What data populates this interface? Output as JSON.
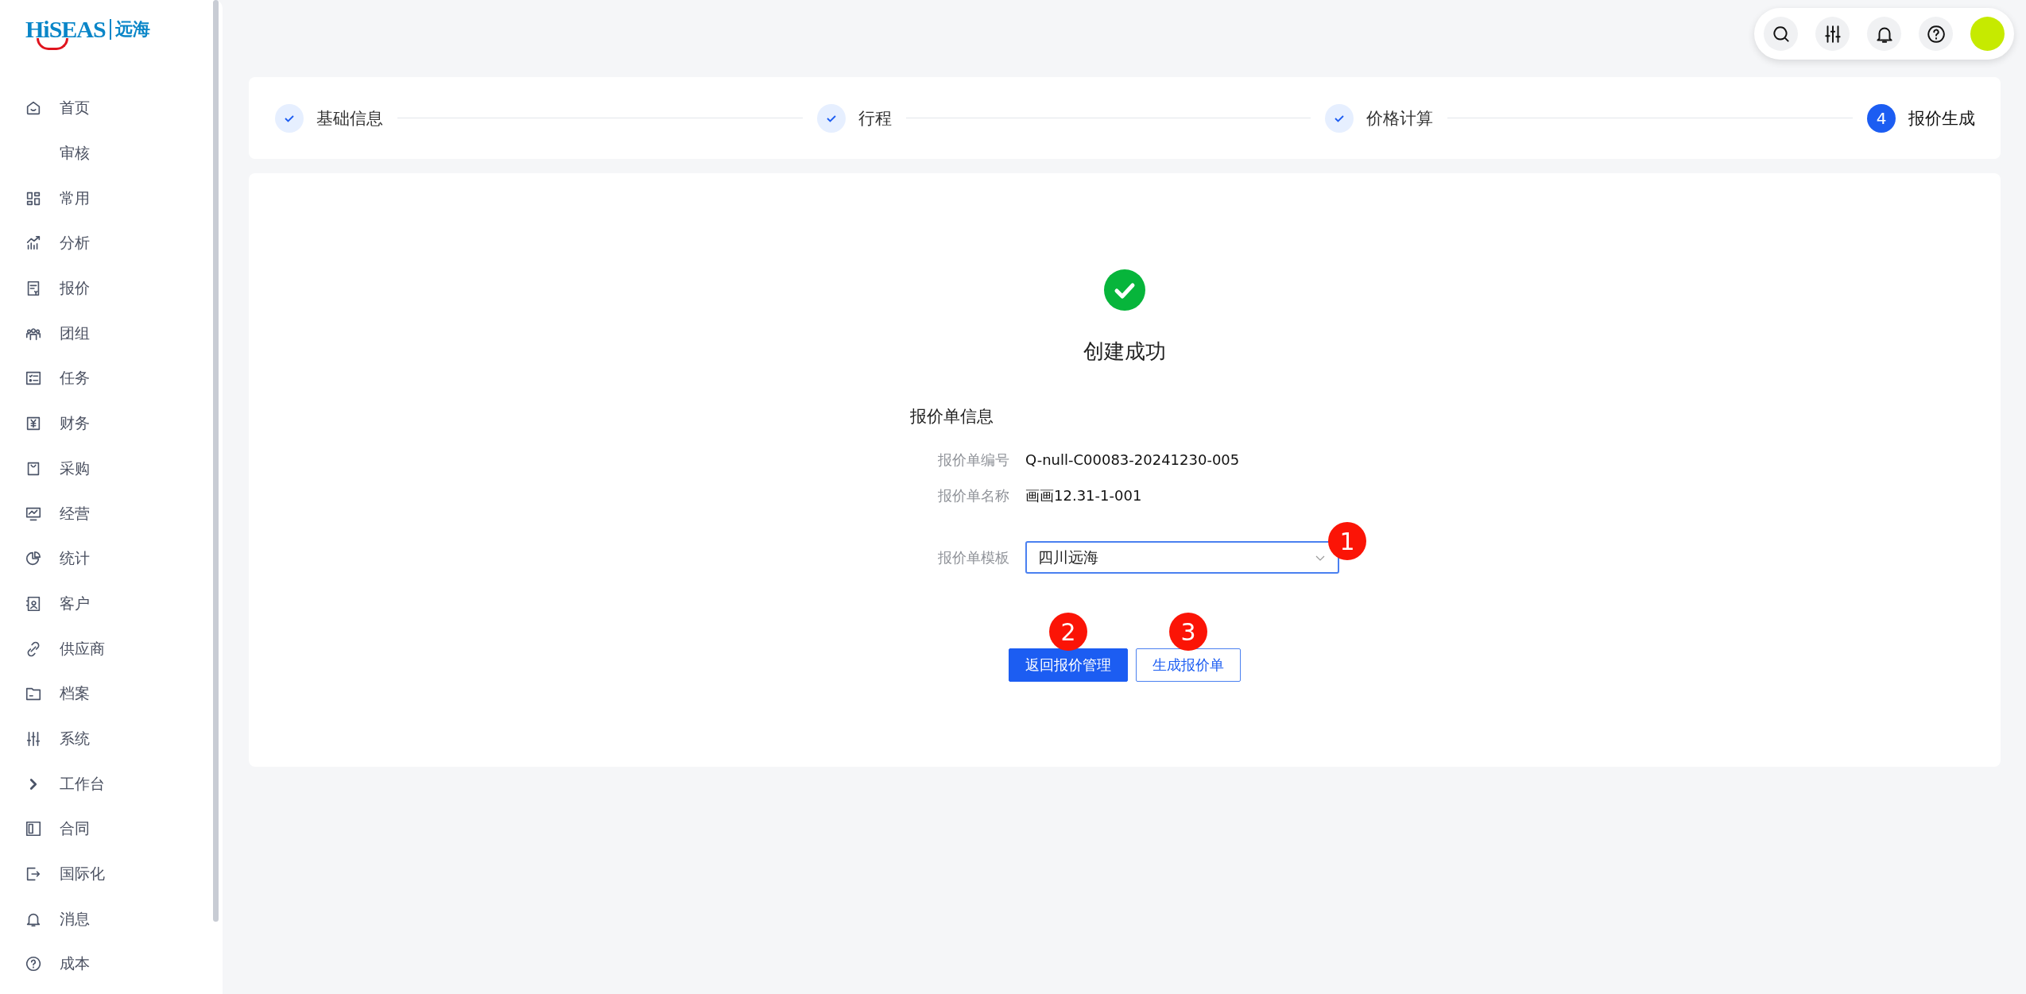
{
  "logo": {
    "brand": "HiSEAS",
    "cn": "远海"
  },
  "sidebar": {
    "items": [
      {
        "label": "首页"
      },
      {
        "label": "审核"
      },
      {
        "label": "常用"
      },
      {
        "label": "分析"
      },
      {
        "label": "报价"
      },
      {
        "label": "团组"
      },
      {
        "label": "任务"
      },
      {
        "label": "财务"
      },
      {
        "label": "采购"
      },
      {
        "label": "经营"
      },
      {
        "label": "统计"
      },
      {
        "label": "客户"
      },
      {
        "label": "供应商"
      },
      {
        "label": "档案"
      },
      {
        "label": "系统"
      },
      {
        "label": "工作台"
      },
      {
        "label": "合同"
      },
      {
        "label": "国际化"
      },
      {
        "label": "消息"
      },
      {
        "label": "成本"
      }
    ]
  },
  "steps": [
    {
      "label": "基础信息",
      "done": true
    },
    {
      "label": "行程",
      "done": true
    },
    {
      "label": "价格计算",
      "done": true
    },
    {
      "label": "报价生成",
      "done": false,
      "number": "4"
    }
  ],
  "result": {
    "title": "创建成功",
    "section": "报价单信息",
    "fields": [
      {
        "label": "报价单编号",
        "value": "Q-null-C00083-20241230-005"
      },
      {
        "label": "报价单名称",
        "value": "画画12.31-1-001"
      }
    ],
    "template": {
      "label": "报价单模板",
      "value": "四川远海",
      "marker": "1"
    },
    "buttons": [
      {
        "label": "返回报价管理",
        "kind": "primary",
        "marker": "2"
      },
      {
        "label": "生成报价单",
        "kind": "outline",
        "marker": "3"
      }
    ]
  }
}
